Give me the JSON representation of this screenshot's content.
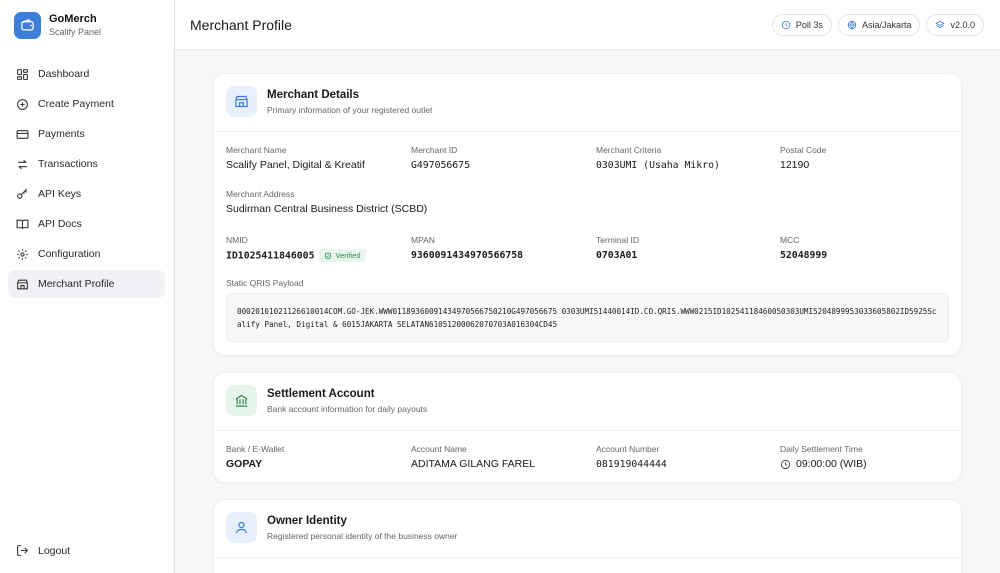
{
  "brand": {
    "name": "GoMerch",
    "subtitle": "Scalify Panel"
  },
  "nav": {
    "items": [
      {
        "label": "Dashboard",
        "icon": "grid-icon"
      },
      {
        "label": "Create Payment",
        "icon": "plus-circle-icon"
      },
      {
        "label": "Payments",
        "icon": "credit-card-icon"
      },
      {
        "label": "Transactions",
        "icon": "arrows-swap-icon"
      },
      {
        "label": "API Keys",
        "icon": "key-icon"
      },
      {
        "label": "API Docs",
        "icon": "book-icon"
      },
      {
        "label": "Configuration",
        "icon": "gear-icon"
      },
      {
        "label": "Merchant Profile",
        "icon": "store-icon",
        "active": true
      }
    ],
    "logout": "Logout"
  },
  "header": {
    "title": "Merchant Profile",
    "poll": "Poll 3s",
    "timezone": "Asia/Jakarta",
    "version": "v2.0.0"
  },
  "merchant": {
    "title": "Merchant Details",
    "subtitle": "Primary information of your registered outlet",
    "name_label": "Merchant Name",
    "name": "Scalify Panel, Digital & Kreatif",
    "id_label": "Merchant ID",
    "id": "G497056675",
    "criteria_label": "Merchant Criteria",
    "criteria": "0303UMI (Usaha Mikro)",
    "postal_label": "Postal Code",
    "postal": "12190",
    "address_label": "Merchant Address",
    "address": "Sudirman Central Business District (SCBD)",
    "nmid_label": "NMID",
    "nmid": "ID1025411846005",
    "verified": "Verified",
    "mpan_label": "MPAN",
    "mpan": "9360091434970566758",
    "terminal_label": "Terminal ID",
    "terminal": "0703A01",
    "mcc_label": "MCC",
    "mcc": "52048999",
    "payload_label": "Static QRIS Payload",
    "payload": "00020101021126610014COM.GO-JEK.WWW01189360091434970566750210G497056675 0303UMI51440014ID.CO.QRIS.WWW0215ID10254118460050303UMI5204899953033605802ID5925Scalify Panel, Digital & 6015JAKARTA SELATAN61051200062070703A016304CD45"
  },
  "settlement": {
    "title": "Settlement Account",
    "subtitle": "Bank account information for daily payouts",
    "bank_label": "Bank / E-Wallet",
    "bank": "GOPAY",
    "account_name_label": "Account Name",
    "account_name": "ADITAMA GILANG FAREL",
    "account_number_label": "Account Number",
    "account_number": "081919044444",
    "time_label": "Daily Settlement Time",
    "time": "09:00:00 (WIB)"
  },
  "owner": {
    "title": "Owner Identity",
    "subtitle": "Registered personal identity of the business owner"
  },
  "colors": {
    "accent": "#3d7fd8",
    "verified_green": "#2f8a4e",
    "active_bg": "#eff1f5"
  }
}
